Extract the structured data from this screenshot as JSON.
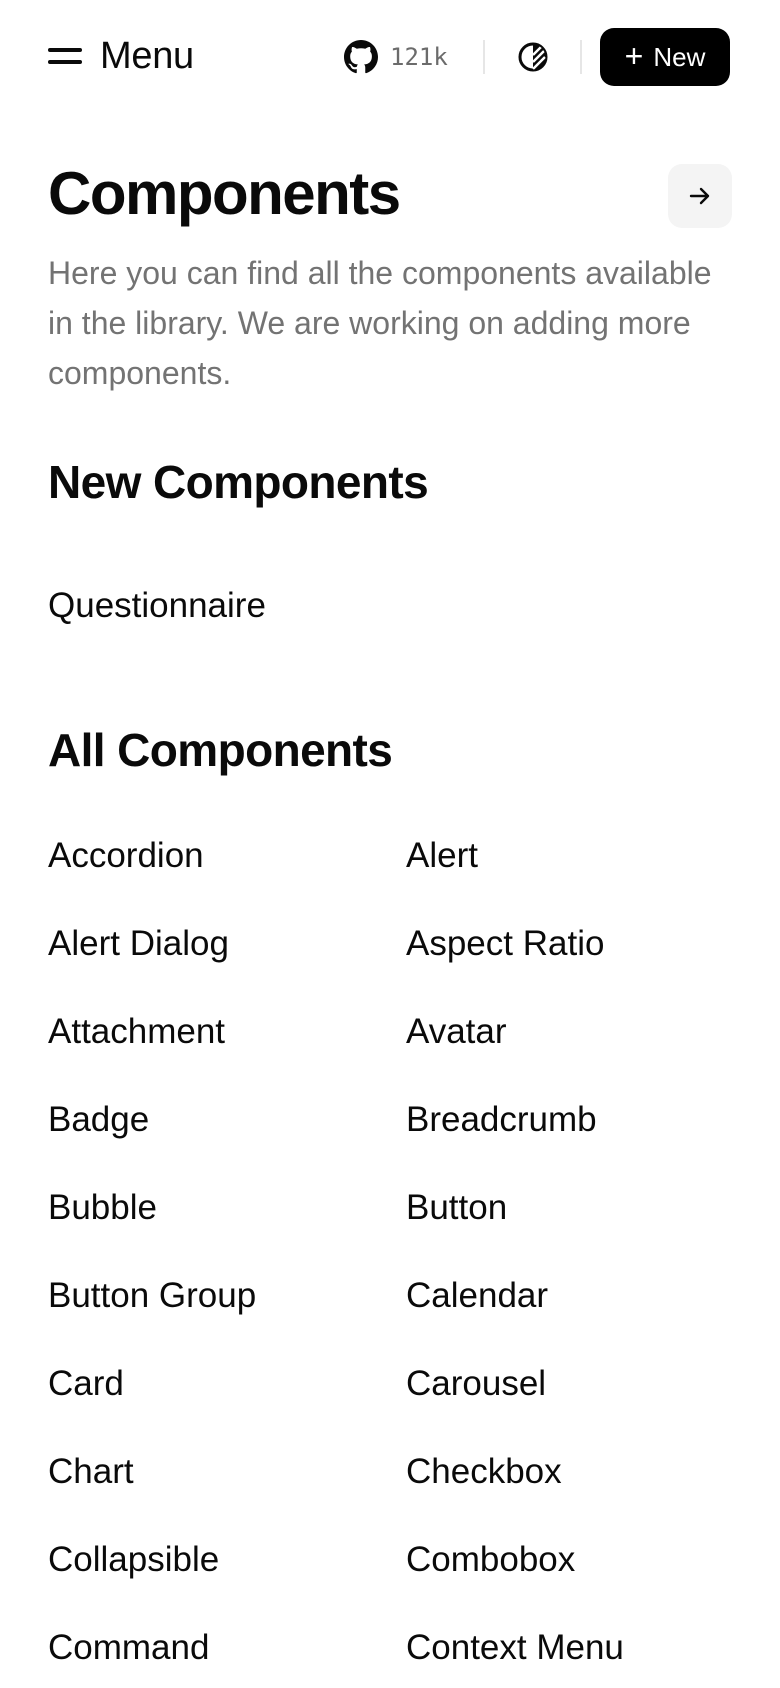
{
  "header": {
    "menu_label": "Menu",
    "github_stars": "121k",
    "new_button_label": "New",
    "icons": {
      "menu": "menu-icon",
      "github": "github-icon",
      "theme": "theme-toggle-icon",
      "plus": "plus-icon",
      "arrow": "arrow-right-icon"
    }
  },
  "page": {
    "title": "Components",
    "description": "Here you can find all the components available in the library. We are working on adding more components."
  },
  "new_components": {
    "title": "New Components",
    "items": [
      "Questionnaire"
    ]
  },
  "all_components": {
    "title": "All Components",
    "items": [
      "Accordion",
      "Alert",
      "Alert Dialog",
      "Aspect Ratio",
      "Attachment",
      "Avatar",
      "Badge",
      "Breadcrumb",
      "Bubble",
      "Button",
      "Button Group",
      "Calendar",
      "Card",
      "Carousel",
      "Chart",
      "Checkbox",
      "Collapsible",
      "Combobox",
      "Command",
      "Context Menu"
    ]
  },
  "colors": {
    "text": "#0a0a0a",
    "muted": "#737373",
    "button_bg": "#000000",
    "button_text": "#ffffff",
    "secondary_bg": "#f4f4f4",
    "divider": "#e6e6e6"
  }
}
